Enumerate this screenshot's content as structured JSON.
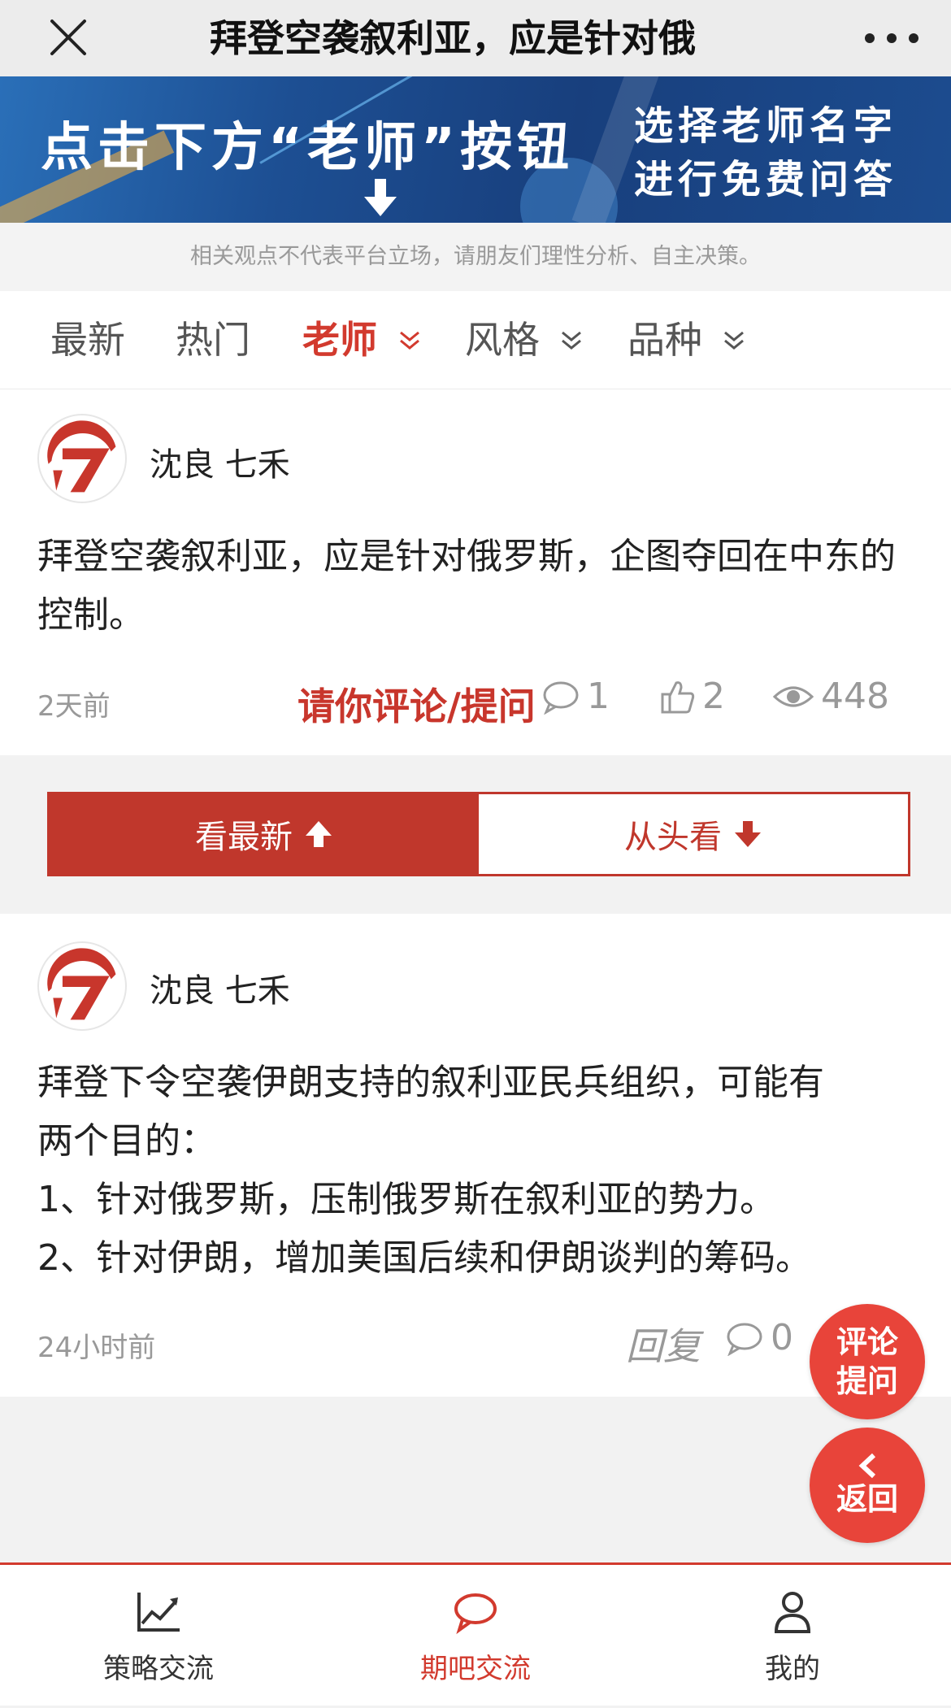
{
  "header": {
    "title": "拜登空袭叙利亚，应是针对俄",
    "close_icon": "close-icon",
    "more_icon": "more-icon"
  },
  "banner": {
    "main_text": "点击下方“老师”按钮",
    "side_line1": "选择老师名字",
    "side_line2": "进行免费问答"
  },
  "notice": "相关观点不代表平台立场，请朋友们理性分析、自主决策。",
  "tabs": [
    {
      "label": "最新",
      "active": false,
      "dropdown": false
    },
    {
      "label": "热门",
      "active": false,
      "dropdown": false
    },
    {
      "label": "老师",
      "active": true,
      "dropdown": true
    },
    {
      "label": "风格",
      "active": false,
      "dropdown": true
    },
    {
      "label": "品种",
      "active": false,
      "dropdown": true
    }
  ],
  "posts": [
    {
      "author": "沈良 七禾",
      "content": "拜登空袭叙利亚，应是针对俄罗斯，企图夺回在中东的控制。",
      "time": "2天前",
      "ask_label": "请你评论/提问",
      "comments": "1",
      "likes": "2",
      "views": "448"
    },
    {
      "author": "沈良 七禾",
      "content_lines": [
        "拜登下令空袭伊朗支持的叙利亚民兵组织，可能有",
        "两个目的：",
        "1、针对俄罗斯，压制俄罗斯在叙利亚的势力。",
        "2、针对伊朗，增加美国后续和伊朗谈判的筹码。"
      ],
      "time": "24小时前",
      "reply_label": "回复",
      "comments": "0"
    }
  ],
  "switch": {
    "latest_label": "看最新",
    "from_start_label": "从头看"
  },
  "floating": {
    "comment_line1": "评论",
    "comment_line2": "提问",
    "back_label": "返回"
  },
  "bottom_nav": [
    {
      "label": "策略交流",
      "icon": "chart-line-icon",
      "active": false
    },
    {
      "label": "期吧交流",
      "icon": "chat-bubble-icon",
      "active": true
    },
    {
      "label": "我的",
      "icon": "user-icon",
      "active": false
    }
  ],
  "colors": {
    "accent": "#d23a2e",
    "switch_red": "#c0372c",
    "float_red": "#e8443a",
    "header_bg": "#ececec"
  }
}
